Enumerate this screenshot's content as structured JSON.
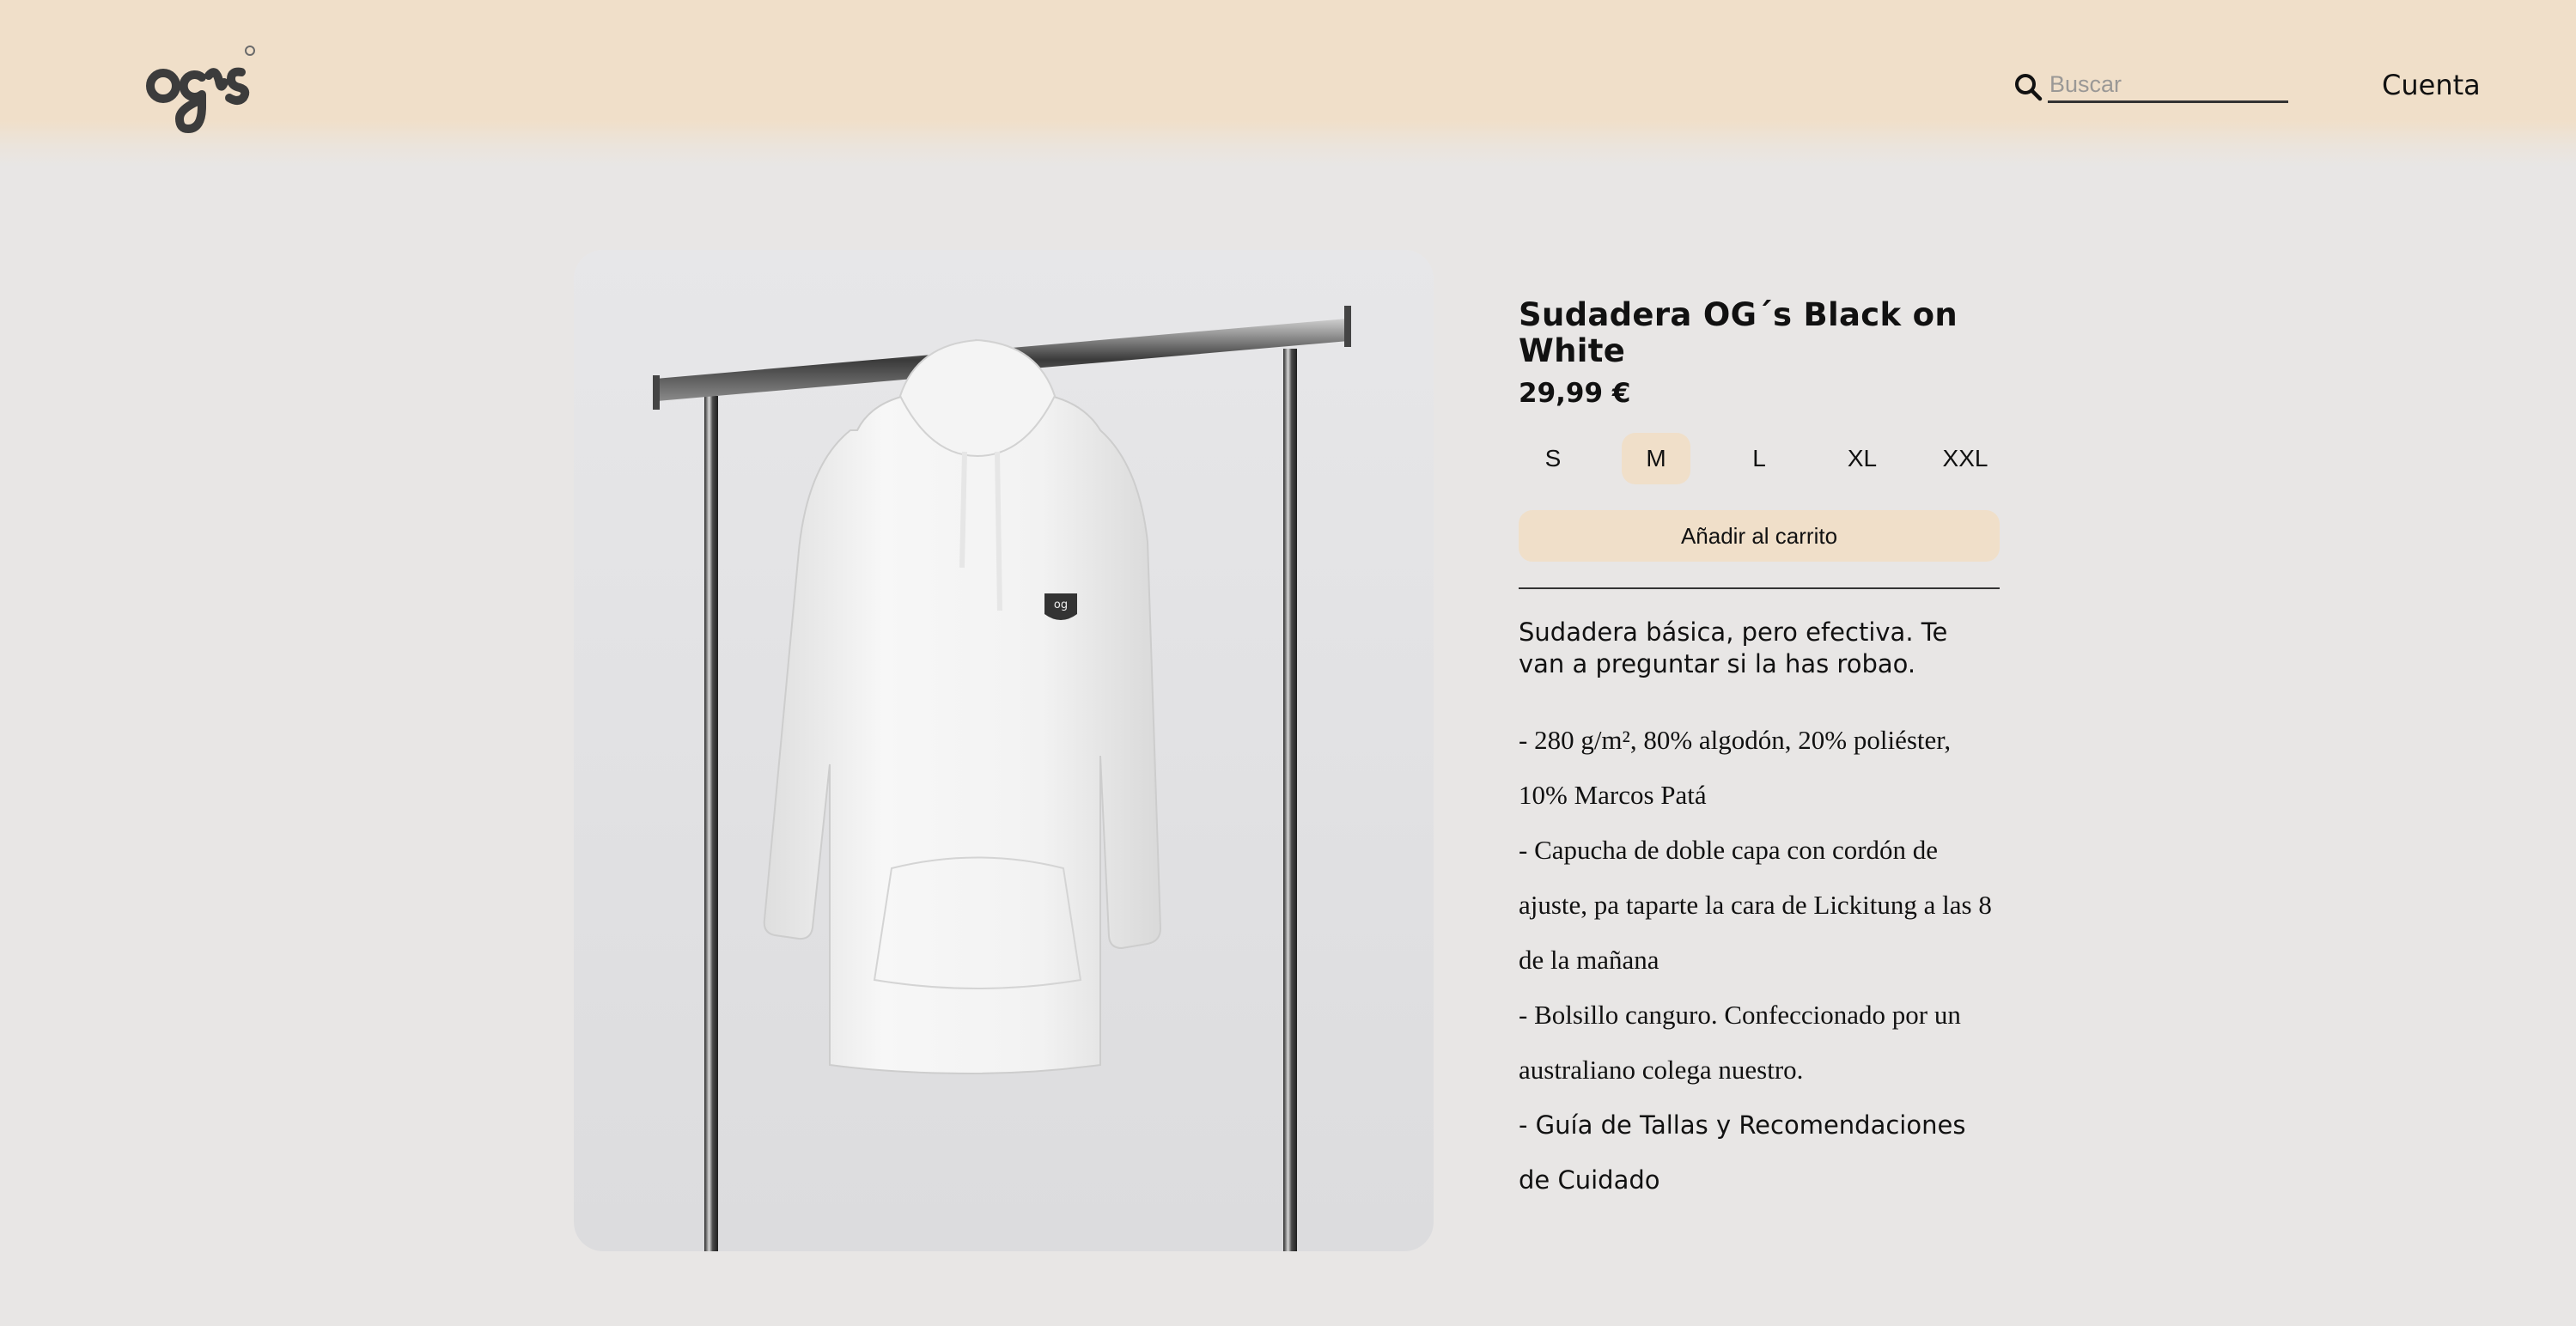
{
  "header": {
    "logo_text": "og's",
    "search": {
      "placeholder": "Buscar",
      "value": ""
    },
    "account_label": "Cuenta"
  },
  "product": {
    "title": "Sudadera OG´s Black on White",
    "price": "29,99 €",
    "sizes": [
      "S",
      "M",
      "L",
      "XL",
      "XXL"
    ],
    "selected_size": "M",
    "add_to_cart_label": "Añadir al carrito",
    "description_intro": "Sudadera básica, pero efectiva. Te van a preguntar si la has robao.",
    "features": [
      "- 280 g/m², 80% algodón, 20% poliéster, 10% Marcos Patá",
      "- Capucha de doble capa con cordón de ajuste, pa taparte la cara de Lickitung a las 8 de la mañana",
      "- Bolsillo canguro. Confeccionado por un australiano colega nuestro.",
      "- Guía de Tallas y Recomendaciones de Cuidado"
    ]
  },
  "colors": {
    "header_bg": "#f0dfc9",
    "page_bg": "#e8e6e5",
    "accent": "#f0dfc9",
    "text": "#111111"
  },
  "icons": {
    "search": "search-icon",
    "logo": "logo-icon"
  }
}
